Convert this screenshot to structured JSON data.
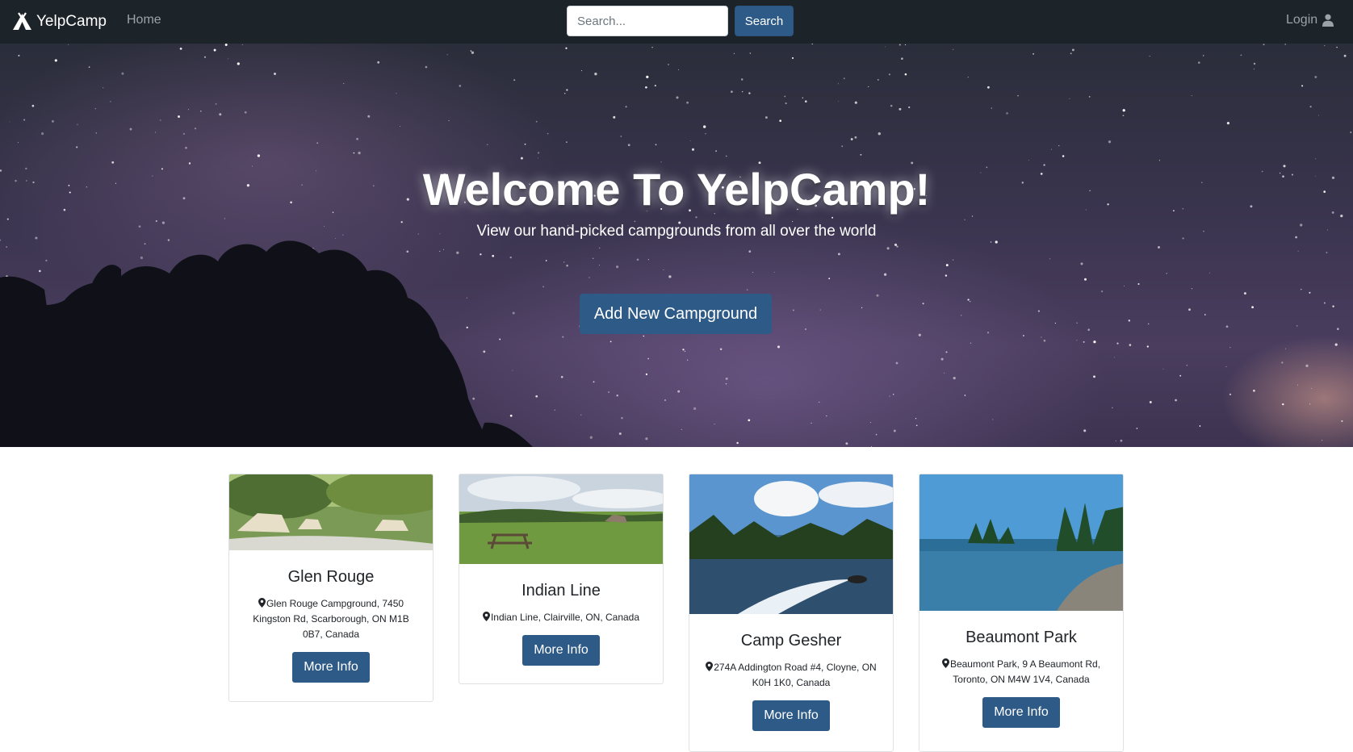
{
  "navbar": {
    "brand": "YelpCamp",
    "home_label": "Home",
    "search_placeholder": "Search...",
    "search_button": "Search",
    "login_label": "Login"
  },
  "hero": {
    "title": "Welcome To YelpCamp!",
    "subtitle": "View our hand-picked campgrounds from all over the world",
    "button": "Add New Campground"
  },
  "campgrounds": [
    {
      "name": "Glen Rouge",
      "location": "Glen Rouge Campground, 7450 Kingston Rd, Scarborough, ON M1B 0B7, Canada",
      "button": "More Info"
    },
    {
      "name": "Indian Line",
      "location": "Indian Line, Clairville, ON, Canada",
      "button": "More Info"
    },
    {
      "name": "Camp Gesher",
      "location": "274A Addington Road #4, Cloyne, ON K0H 1K0, Canada",
      "button": "More Info"
    },
    {
      "name": "Beaumont Park",
      "location": "Beaumont Park, 9 A Beaumont Rd, Toronto, ON M4W 1V4, Canada",
      "button": "More Info"
    }
  ],
  "icons": {
    "brand": "campground-icon",
    "login": "user-icon",
    "location": "map-marker-icon"
  },
  "colors": {
    "navbar": "#1c2329",
    "primary_button": "#2e5a87"
  }
}
